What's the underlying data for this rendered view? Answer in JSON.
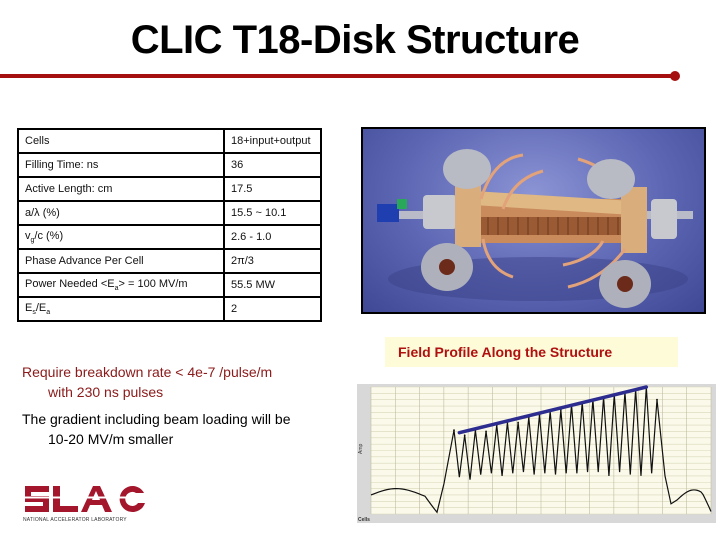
{
  "slide": {
    "title": "CLIC T18-Disk Structure",
    "accent_color": "#a50f0f"
  },
  "specs_table": {
    "rows": [
      {
        "label": "Cells",
        "value": "18+input+output"
      },
      {
        "label": "Filling Time: ns",
        "value": "36"
      },
      {
        "label": "Active Length: cm",
        "value": "17.5"
      },
      {
        "label": "a/λ (%)",
        "value": "15.5 ~ 10.1"
      },
      {
        "label_main": "v",
        "label_sub": "g",
        "label_rest": "/c (%)",
        "value": "2.6 - 1.0"
      },
      {
        "label": "Phase Advance Per Cell",
        "value": "2π/3"
      },
      {
        "label_pre": "Power Needed <E",
        "label_sub": "a",
        "label_post": "> = 100 MV/m",
        "value": "55.5 MW"
      },
      {
        "label_e1": "E",
        "label_sub1": "s",
        "label_mid": "/E",
        "label_sub2": "a",
        "value": "2"
      }
    ]
  },
  "photo": {
    "subject": "T18 disk accelerating structure photo"
  },
  "notes": {
    "requirement_line1": "Require breakdown rate < 4e-7 /pulse/m",
    "requirement_line2": "with 230 ns pulses",
    "gradient_line1": "The gradient including beam loading will be",
    "gradient_line2": "10-20 MV/m smaller"
  },
  "chart_panel": {
    "title": "Field Profile Along the Structure",
    "title_color": "#b01010",
    "title_bg": "#fdfbd8"
  },
  "chart_data": {
    "type": "line",
    "title": "Field Profile Along the Structure",
    "xlabel": "Cells",
    "ylabel": "Amp",
    "ylim": [
      0,
      5.0
    ],
    "grid": true,
    "note": "Tick labels in the embedded plot are illegible; values are approximate in relative amplitude units.",
    "series": [
      {
        "name": "Measured field amplitude",
        "color": "#111111",
        "cell_peaks": [
          3.3,
          3.1,
          3.3,
          3.25,
          3.5,
          3.6,
          3.6,
          3.8,
          3.9,
          4.05,
          4.1,
          4.3,
          4.4,
          4.5,
          4.6,
          4.7,
          4.8,
          4.9,
          5.0,
          4.5
        ],
        "cell_troughs": [
          1.45,
          1.35,
          1.55,
          1.6,
          1.5,
          1.6,
          1.65,
          1.55,
          1.6,
          1.55,
          1.6,
          1.6,
          1.65,
          1.65,
          1.5,
          1.65,
          1.55,
          1.5,
          1.6
        ],
        "input_region_level": 0.75,
        "output_region_level": 0.75
      },
      {
        "name": "Peak envelope (trend line)",
        "color": "#2d2d8f",
        "start": 3.2,
        "end": 5.0
      }
    ]
  },
  "logo": {
    "name": "SLAC",
    "subtitle": "NATIONAL ACCELERATOR LABORATORY",
    "color": "#a3162b"
  }
}
